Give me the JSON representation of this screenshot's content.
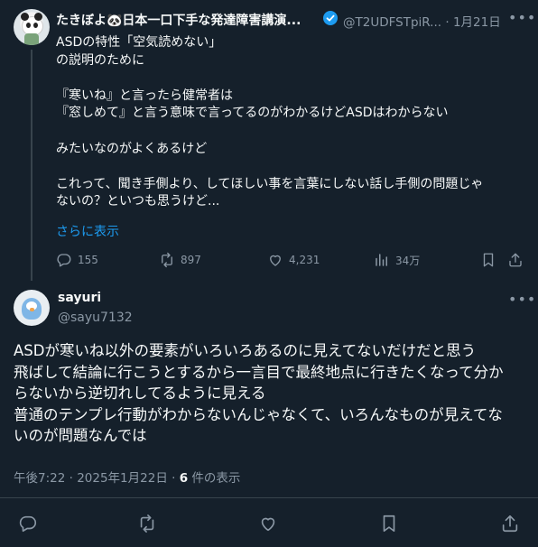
{
  "post1": {
    "display_name": "たきぼよ🐼日本一口下手な発達障害講演...",
    "handle": "@T2UDFSTpiR...",
    "date": "· 1月21日",
    "lines": [
      "ASDの特性「空気読めない」",
      "の説明のために",
      "",
      "『寒いね』と言ったら健常者は",
      "『窓しめて』と言う意味で言ってるのがわかるけどASDはわからない",
      "",
      "みたいなのがよくあるけど",
      "",
      "これって、聞き手側より、してほしい事を言葉にしない話し手側の問題じゃ",
      "ないの？といつも思うけど..."
    ],
    "show_more": "さらに表示",
    "replies": "155",
    "reposts": "897",
    "likes": "4,231",
    "views": "34万"
  },
  "post2": {
    "display_name": "sayuri",
    "handle": "@sayu7132",
    "lines": [
      "ASDが寒いね以外の要素がいろいろあるのに見えてないだけだと思う",
      "飛ばして結論に行こうとするから一言目で最終地点に行きたくなって分か",
      "らないから逆切れしてるように見える",
      "普通のテンプレ行動がわからないんじゃなくて、いろんなものが見えてな",
      "いのが問題なんでは"
    ],
    "timestamp": "午後7:22 · 2025年1月22日 · ",
    "views_count": "6",
    "views_label": " 件の表示"
  },
  "colors": {
    "background": "#15202b",
    "text": "#f7f9f9",
    "muted": "#8b98a5",
    "accent": "#1d9bf0",
    "border": "#38444d"
  },
  "icons": [
    "more-icon",
    "verified-badge-icon",
    "reply-icon",
    "repost-icon",
    "like-icon",
    "views-icon",
    "bookmark-icon",
    "share-icon"
  ]
}
